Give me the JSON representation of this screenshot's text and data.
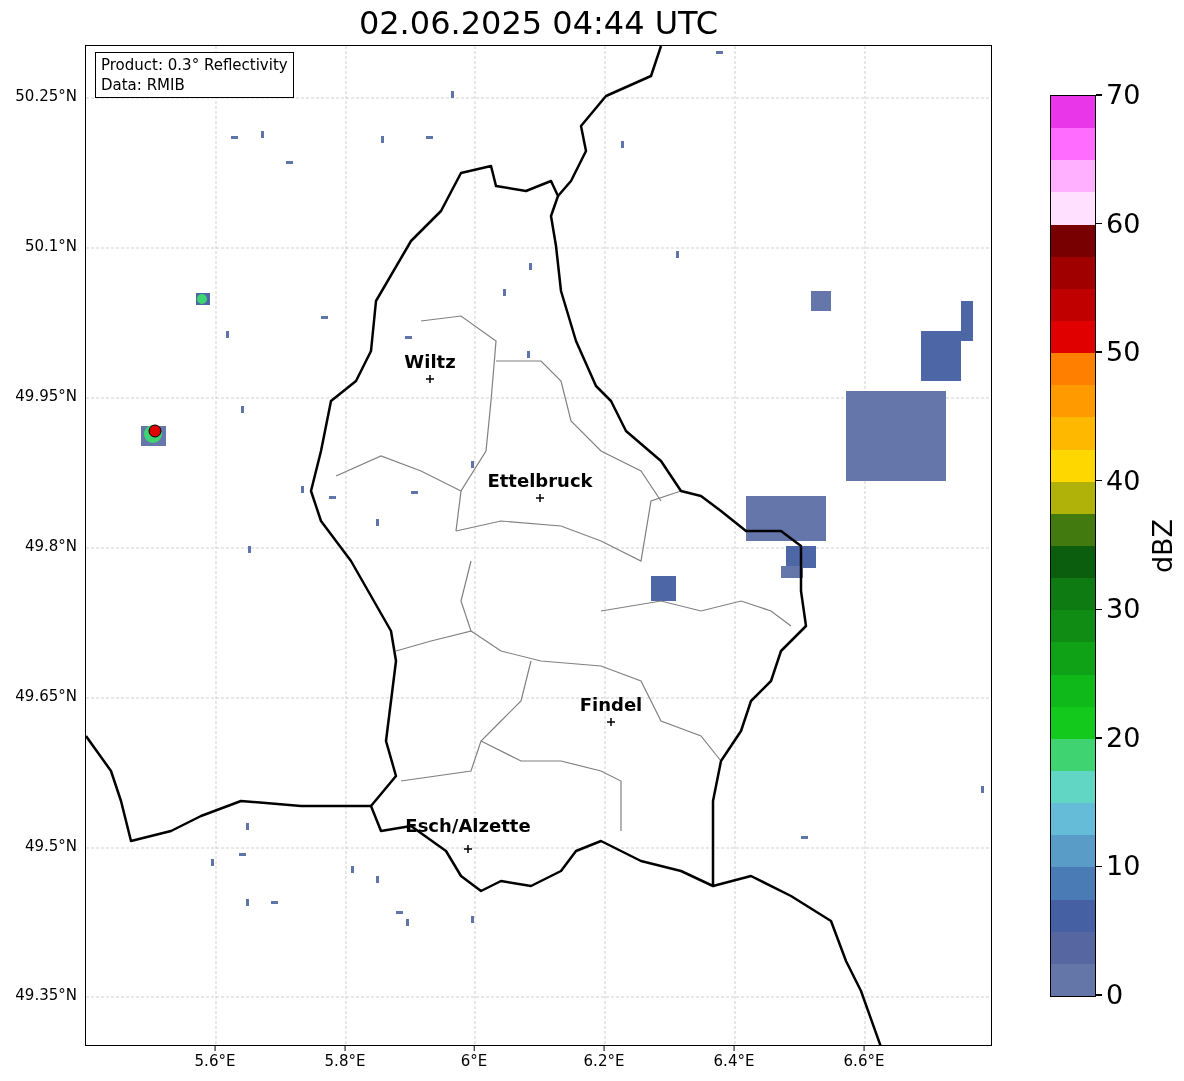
{
  "title": "02.06.2025 04:44 UTC",
  "info_box": {
    "lines": [
      "Product: 0.3° Reflectivity",
      "Data: RMIB"
    ]
  },
  "map": {
    "y_ticks": [
      "50.25°N",
      "50.1°N",
      "49.95°N",
      "49.8°N",
      "49.65°N",
      "49.5°N",
      "49.35°N"
    ],
    "x_ticks": [
      "5.6°E",
      "5.8°E",
      "6°E",
      "6.2°E",
      "6.4°E",
      "6.6°E"
    ],
    "cities": [
      {
        "name": "Wiltz"
      },
      {
        "name": "Ettelbruck"
      },
      {
        "name": "Findel"
      },
      {
        "name": "Esch/Alzette"
      }
    ]
  },
  "colorbar": {
    "label": "dBZ",
    "ticks": [
      "70",
      "60",
      "50",
      "40",
      "30",
      "20",
      "10",
      "0"
    ],
    "colors": [
      {
        "color": "#e836e8"
      },
      {
        "color": "#ff6cff"
      },
      {
        "color": "#ffb0ff"
      },
      {
        "color": "#ffe0ff"
      },
      {
        "color": "#780000"
      },
      {
        "color": "#a00000"
      },
      {
        "color": "#c00000"
      },
      {
        "color": "#e00000"
      },
      {
        "color": "#ff7f00"
      },
      {
        "color": "#ff9a00"
      },
      {
        "color": "#ffb800"
      },
      {
        "color": "#ffd700"
      },
      {
        "color": "#b0b20a"
      },
      {
        "color": "#437a10"
      },
      {
        "color": "#0a5e0d"
      },
      {
        "color": "#0e7a12"
      },
      {
        "color": "#108c14"
      },
      {
        "color": "#0fa216"
      },
      {
        "color": "#10b91a"
      },
      {
        "color": "#12c91c"
      },
      {
        "color": "#3fd471"
      },
      {
        "color": "#62d6c4"
      },
      {
        "color": "#64bcd8"
      },
      {
        "color": "#5a9cc8"
      },
      {
        "color": "#4a7bb5"
      },
      {
        "color": "#4560a3"
      },
      {
        "color": "#5566a0"
      },
      {
        "color": "#6475a8"
      }
    ]
  }
}
